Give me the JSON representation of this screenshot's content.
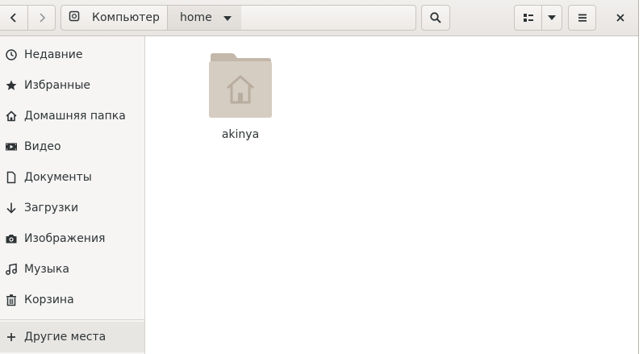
{
  "header": {
    "path": [
      {
        "label": "Компьютер",
        "icon": "drive-icon"
      },
      {
        "label": "home",
        "icon": "chevron-down-icon"
      }
    ],
    "buttons": {
      "back": "chevron-left-icon",
      "forward": "chevron-right-icon",
      "search": "search-icon",
      "view": "list-view-icon",
      "view_options": "chevron-down-icon",
      "menu": "hamburger-menu-icon",
      "close": "close-icon"
    }
  },
  "sidebar": {
    "items": [
      {
        "label": "Недавние",
        "icon": "clock-icon"
      },
      {
        "label": "Избранные",
        "icon": "star-icon"
      },
      {
        "label": "Домашняя папка",
        "icon": "home-icon"
      },
      {
        "label": "Видео",
        "icon": "video-icon"
      },
      {
        "label": "Документы",
        "icon": "document-icon"
      },
      {
        "label": "Загрузки",
        "icon": "download-icon"
      },
      {
        "label": "Изображения",
        "icon": "camera-icon"
      },
      {
        "label": "Музыка",
        "icon": "music-icon"
      },
      {
        "label": "Корзина",
        "icon": "trash-icon"
      }
    ],
    "other_locations": {
      "label": "Другие места",
      "icon": "plus-icon"
    }
  },
  "main": {
    "items": [
      {
        "name": "akinya",
        "icon": "home-folder-icon"
      }
    ]
  },
  "colors": {
    "folder": "#d6cdc2",
    "folder_tab": "#c4b8ab",
    "sidebar_bg": "#f6f5f4",
    "header_bg": "#e8e5e2"
  }
}
